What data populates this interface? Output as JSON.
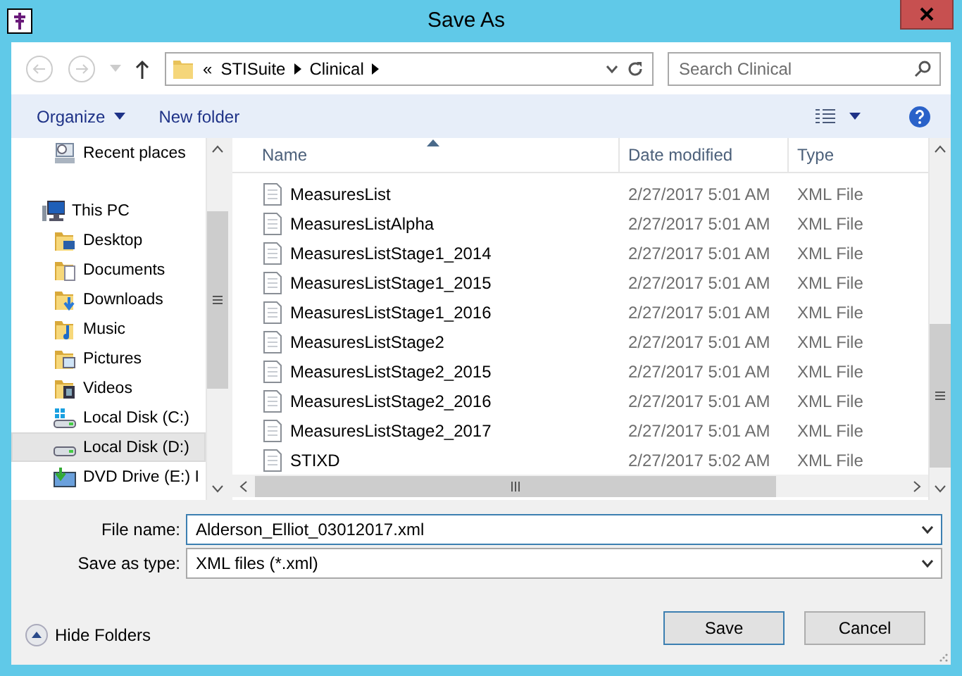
{
  "window": {
    "title": "Save As"
  },
  "address": {
    "overflow": "«",
    "segments": [
      "STISuite",
      "Clinical"
    ]
  },
  "search": {
    "placeholder": "Search Clinical"
  },
  "commands": [
    {
      "label": "Organize",
      "dropdown": true
    },
    {
      "label": "New folder",
      "dropdown": false
    }
  ],
  "sidebar": {
    "items": [
      {
        "label": "Recent places",
        "kind": "recent",
        "selected": false
      },
      {
        "label": "This PC",
        "kind": "pc",
        "selected": false,
        "children": [
          {
            "label": "Desktop",
            "kind": "desktop",
            "selected": false
          },
          {
            "label": "Documents",
            "kind": "documents",
            "selected": false
          },
          {
            "label": "Downloads",
            "kind": "downloads",
            "selected": false
          },
          {
            "label": "Music",
            "kind": "music",
            "selected": false
          },
          {
            "label": "Pictures",
            "kind": "pictures",
            "selected": false
          },
          {
            "label": "Videos",
            "kind": "videos",
            "selected": false
          },
          {
            "label": "Local Disk (C:)",
            "kind": "system-disk",
            "selected": false
          },
          {
            "label": "Local Disk (D:)",
            "kind": "disk",
            "selected": true
          },
          {
            "label": "DVD Drive (E:) I",
            "kind": "dvd",
            "selected": false
          }
        ]
      }
    ]
  },
  "file_list": {
    "columns": [
      {
        "label": "Name",
        "sorted": true
      },
      {
        "label": "Date modified",
        "sorted": false
      },
      {
        "label": "Type",
        "sorted": false
      }
    ],
    "rows": [
      {
        "name": "MeasuresList",
        "date": "2/27/2017 5:01 AM",
        "type": "XML File"
      },
      {
        "name": "MeasuresListAlpha",
        "date": "2/27/2017 5:01 AM",
        "type": "XML File"
      },
      {
        "name": "MeasuresListStage1_2014",
        "date": "2/27/2017 5:01 AM",
        "type": "XML File"
      },
      {
        "name": "MeasuresListStage1_2015",
        "date": "2/27/2017 5:01 AM",
        "type": "XML File"
      },
      {
        "name": "MeasuresListStage1_2016",
        "date": "2/27/2017 5:01 AM",
        "type": "XML File"
      },
      {
        "name": "MeasuresListStage2",
        "date": "2/27/2017 5:01 AM",
        "type": "XML File"
      },
      {
        "name": "MeasuresListStage2_2015",
        "date": "2/27/2017 5:01 AM",
        "type": "XML File"
      },
      {
        "name": "MeasuresListStage2_2016",
        "date": "2/27/2017 5:01 AM",
        "type": "XML File"
      },
      {
        "name": "MeasuresListStage2_2017",
        "date": "2/27/2017 5:01 AM",
        "type": "XML File"
      },
      {
        "name": "STIXD",
        "date": "2/27/2017 5:02 AM",
        "type": "XML File"
      }
    ]
  },
  "form": {
    "fields": [
      {
        "label": "File name:",
        "value": "Alderson_Elliot_03012017.xml"
      },
      {
        "label": "Save as type:",
        "value": "XML files (*.xml)"
      }
    ]
  },
  "hide_folders": {
    "label": "Hide Folders"
  },
  "buttons": [
    {
      "label": "Save",
      "default": true
    },
    {
      "label": "Cancel",
      "default": false
    }
  ]
}
